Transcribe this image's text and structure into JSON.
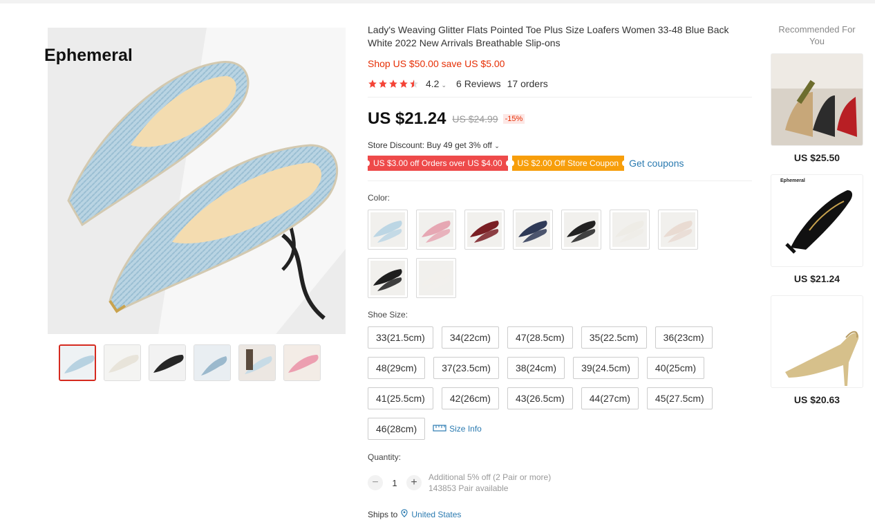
{
  "gallery": {
    "brand": "Ephemeral",
    "thumbnails": [
      "light-blue",
      "white",
      "black",
      "blue-worn",
      "light-blue-pair",
      "pink"
    ]
  },
  "product": {
    "title": "Lady's Weaving Glitter Flats Pointed Toe Plus Size Loafers Women 33-48 Blue Back White 2022 New Arrivals Breathable Slip-ons",
    "shop_price": "Shop US $50.00 save US $5.00",
    "rating": "4.2",
    "reviews": "6 Reviews",
    "orders": "17 orders",
    "price": "US $21.24",
    "original_price": "US $24.99",
    "discount_pct": "-15%",
    "store_discount": "Store Discount: Buy 49 get 3% off",
    "coupons": [
      "US $3.00 off Orders over US $4.00",
      "US $2.00 Off Store Coupon"
    ],
    "get_coupons": "Get coupons",
    "color_label": "Color:",
    "colors": [
      "#bcd6e4",
      "#e6a7b3",
      "#7a1f24",
      "#2f3a57",
      "#222222",
      "#eeece6",
      "#e9dbd2",
      "#1e1e1e",
      "#f2f0ec"
    ],
    "size_label": "Shoe Size:",
    "sizes": [
      "33(21.5cm)",
      "34(22cm)",
      "47(28.5cm)",
      "35(22.5cm)",
      "36(23cm)",
      "48(29cm)",
      "37(23.5cm)",
      "38(24cm)",
      "39(24.5cm)",
      "40(25cm)",
      "41(25.5cm)",
      "42(26cm)",
      "43(26.5cm)",
      "44(27cm)",
      "45(27.5cm)",
      "46(28cm)"
    ],
    "size_info": "Size Info",
    "quantity_label": "Quantity:",
    "quantity": "1",
    "quantity_note": "Additional 5% off (2 Pair or more)",
    "available": "143853 Pair available",
    "ships_to_label": "Ships to",
    "ships_to_country": "United States"
  },
  "recommendations": {
    "title": "Recommended For You",
    "items": [
      {
        "price": "US $25.50"
      },
      {
        "price": "US $21.24",
        "brand": "Ephemeral"
      },
      {
        "price": "US $20.63"
      }
    ]
  },
  "colors": {
    "accent_red": "#e62e04",
    "link_blue": "#2a7ab0",
    "coupon_red": "#ee4a4a",
    "coupon_orange": "#f79e0b",
    "star": "#f44336"
  }
}
